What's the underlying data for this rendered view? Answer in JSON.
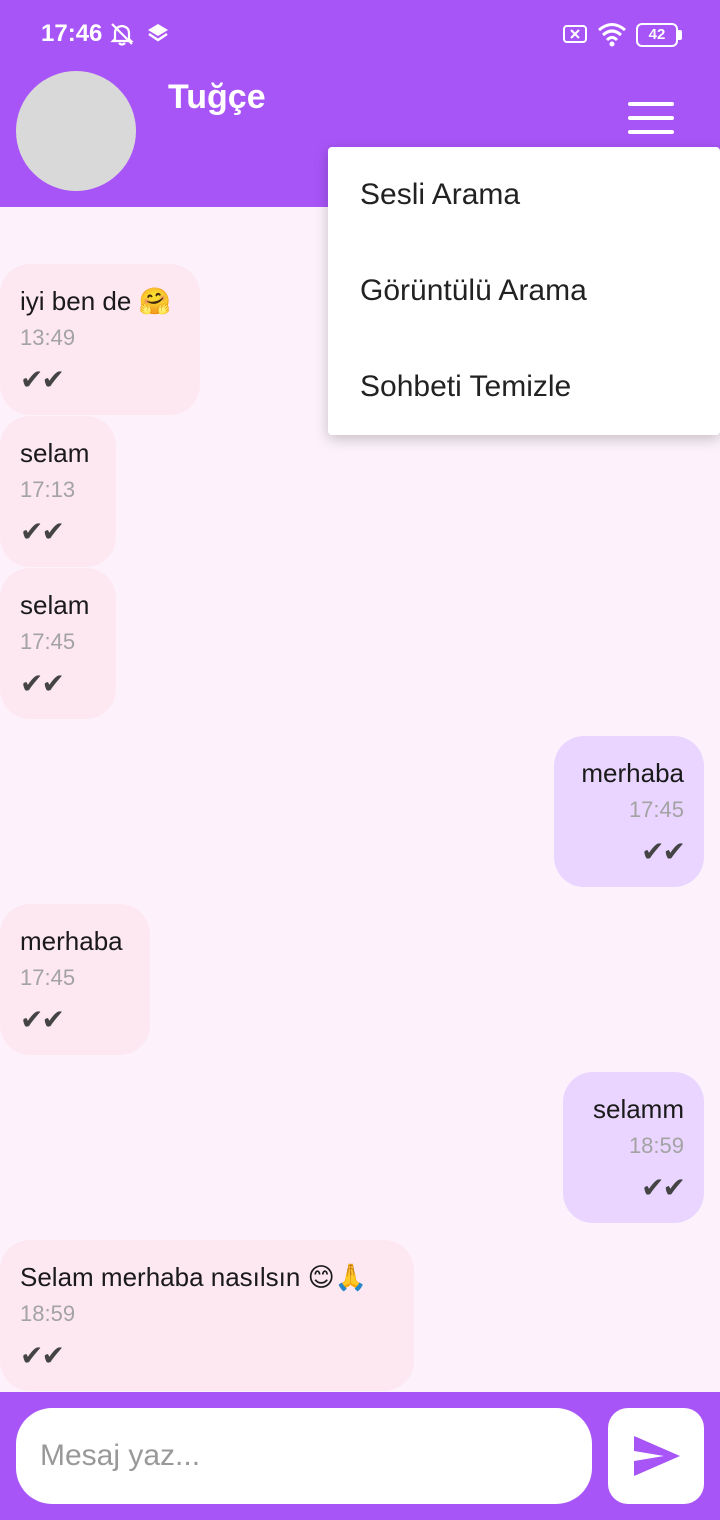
{
  "status": {
    "time": "17:46",
    "battery": "42"
  },
  "header": {
    "contact_name": "Tuğçe"
  },
  "menu": {
    "items": [
      "Sesli Arama",
      "Görüntülü Arama",
      "Sohbeti Temizle"
    ]
  },
  "messages": [
    {
      "text": "iyi ben de 🤗",
      "time": "13:49",
      "ticks": "✔✔",
      "direction": "in"
    },
    {
      "text": "selam",
      "time": "17:13",
      "ticks": "✔✔",
      "direction": "in"
    },
    {
      "text": "selam",
      "time": "17:45",
      "ticks": "✔✔",
      "direction": "in"
    },
    {
      "text": "merhaba",
      "time": "17:45",
      "ticks": "✔✔",
      "direction": "out"
    },
    {
      "text": "merhaba",
      "time": "17:45",
      "ticks": "✔✔",
      "direction": "in"
    },
    {
      "text": "selamm",
      "time": "18:59",
      "ticks": "✔✔",
      "direction": "out"
    },
    {
      "text": "Selam merhaba nasılsın 😊🙏",
      "time": "18:59",
      "ticks": "✔✔",
      "direction": "in"
    }
  ],
  "composer": {
    "placeholder": "Mesaj yaz..."
  },
  "colors": {
    "primary": "#a855f7",
    "incoming_bubble": "#fde7f1",
    "outgoing_bubble": "#e9d5ff",
    "background": "#fdf2fb"
  },
  "icons": {
    "menu": "hamburger-icon",
    "send": "send-icon",
    "status": [
      "mute-bell-icon",
      "layers-icon",
      "sim-error-icon",
      "wifi-icon",
      "battery-icon"
    ]
  }
}
